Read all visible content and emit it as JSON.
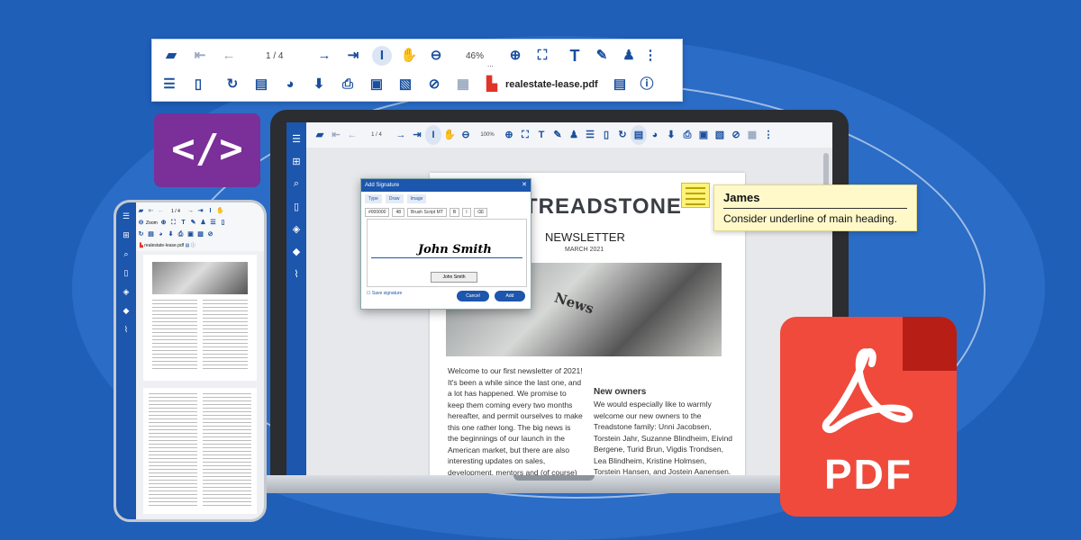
{
  "colors": {
    "background": "#1f5fb8",
    "accent": "#1c56ad",
    "pdf_red": "#f04a3c",
    "code_purple": "#7a2f99",
    "note_yellow": "#fff27a"
  },
  "toolbar": {
    "page_indicator": "1 / 4",
    "zoom": "46%",
    "zoom_more": "...",
    "filename": "realestate-lease.pdf",
    "icons_row1": [
      "folder-open-icon",
      "first-page-icon",
      "prev-page-icon",
      "next-page-icon",
      "last-page-icon",
      "text-select-icon",
      "pan-icon",
      "zoom-out-icon",
      "zoom-in-icon",
      "fit-page-icon",
      "text-icon",
      "draw-icon",
      "stamp-icon",
      "more-icon"
    ],
    "icons_row2": [
      "thumbnails-icon",
      "document-icon",
      "rotate-icon",
      "certificate-icon",
      "palette-icon",
      "download-icon",
      "print-icon",
      "save-icon",
      "image-icon",
      "hide-annotations-icon",
      "layout-icon",
      "pdf-file-icon",
      "document-properties-icon",
      "info-icon"
    ]
  },
  "code_badge": {
    "label": "</>"
  },
  "laptop": {
    "page_indicator": "1 / 4",
    "zoom": "100%",
    "newsletter": {
      "logo": "TREADSTONE",
      "title": "NEWSLETTER",
      "date": "MARCH 2021",
      "photo_word": "News",
      "col1": "Welcome to our first newsletter of 2021! It's been a while since the last one, and a lot has happened. We promise to keep them coming every two months hereafter, and permit ourselves to make this one rather long. The big news is the beginnings of our launch in the American market, but there are also interesting updates on sales, development, mentors and (of course) the investment round that",
      "col2_heading": "New owners",
      "col2": "We would especially like to warmly welcome our new owners to the Treadstone family: Unni Jacobsen, Torstein Jahr, Suzanne Blindheim, Eivind Bergene, Turid Brun, Vigdis Trondsen, Lea Blindheim, Kristine Holmsen, Torstein Hansen, and Jostein Aanensen. We look for-"
    },
    "dialog": {
      "title": "Add Signature",
      "tabs": [
        "Type",
        "Draw",
        "Image"
      ],
      "color": "#000000",
      "size": "48",
      "font": "Brush Script MT",
      "signature": "John Smith",
      "field_value": "John Smith",
      "save_label": "Save signature",
      "cancel": "Cancel",
      "add": "Add"
    }
  },
  "comment": {
    "author": "James",
    "text": "Consider underline of main heading."
  },
  "phone": {
    "page_indicator": "1 / 4",
    "zoom": "Zoom",
    "filename": "realestate-lease.pdf"
  },
  "pdf_icon": {
    "label": "PDF"
  }
}
